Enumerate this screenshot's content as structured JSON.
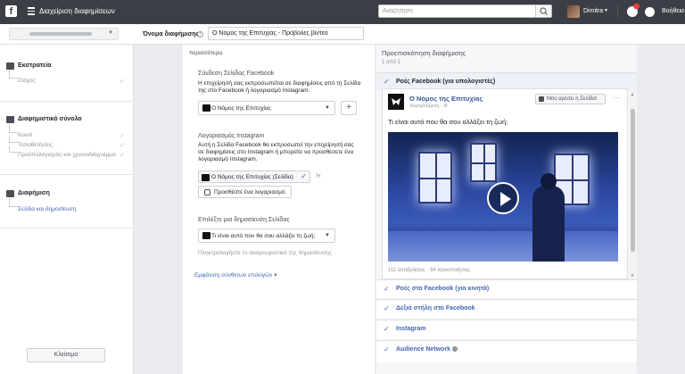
{
  "topbar": {
    "logo": "f",
    "menu_icon": "hamburger-icon",
    "title": "Διαχείριση διαφημίσεων",
    "search_placeholder": "Αναζήτηση",
    "user_name": "Dimitra",
    "help_label": "Βοήθεια"
  },
  "name_bar": {
    "label": "Όνομα διαφήμισης",
    "value": "Ο Νόμος της Επιτυχίας - Προβολές βίντεο"
  },
  "sidebar": {
    "groups": [
      {
        "title": "Εκστρατεία",
        "icon": "folder-icon",
        "items": [
          {
            "label": "Στόχος",
            "checked": true
          }
        ]
      },
      {
        "title": "Διαφημιστικό σύνολο",
        "icon": "grid-icon",
        "items": [
          {
            "label": "Κοινό",
            "checked": true
          },
          {
            "label": "Τοποθετήσεις",
            "checked": true
          },
          {
            "label": "Προϋπολογισμός και χρονοδιάγραμμα",
            "checked": true
          }
        ]
      },
      {
        "title": "Διαφήμιση",
        "icon": "ad-icon",
        "items": [
          {
            "label": "Σελίδα και δημοσίευση",
            "active": true
          }
        ]
      }
    ],
    "close_label": "Κλείσιμο"
  },
  "center": {
    "intro_tail": "περισσότερα.",
    "fb_section": {
      "title": "Σύνδεση Σελίδας Facebook",
      "description_line1": "Η επιχείρησή σας εκπροσωπείται σε διαφημίσεις από τη Σελίδα",
      "description_line2": "της στο Facebook ή λογαριασμό Instagram.",
      "page_value": "Ο Νόμος της Επιτυχίας",
      "plus_label": "+"
    },
    "ig_section": {
      "title": "Λογαριασμός Instagram",
      "description_line1": "Αυτή η Σελίδα Facebook θα εκπροσωπεί την επιχείρησή σας",
      "description_line2": "σε διαφημίσεις στο Instagram ή μπορείτε να προσθέσετε ένα",
      "description_line3": "λογαριασμό Instagram.",
      "selected_page": "Ο Νόμος της Επιτυχίας (Σελίδα)",
      "or_label": "Ή",
      "add_account_label": "Προσθέστε ένα λογαριασμό"
    },
    "post_section": {
      "title": "Επιλέξτε μια δημοσίευση Σελίδας",
      "post_value": "Τι είναι αυτό που θα σου αλλάξει τη ζωή;",
      "hint": "Πληκτρολογήστε το αναγνωριστικό της δημοσίευσης"
    },
    "advanced_link": "Εμφάνιση σύνθετων επιλογών ▾"
  },
  "preview": {
    "title": "Προεπισκόπηση διαφήμισης",
    "count": "1 από 1",
    "placements": [
      {
        "label": "Ροές Facebook (για υπολογιστές)",
        "selected": true
      },
      {
        "label": "Ροές στο Facebook (για κινητά)"
      },
      {
        "label": "Δεξιά στήλη στο Facebook"
      },
      {
        "label": "Instagram"
      },
      {
        "label": "Audience Network",
        "info": true
      }
    ],
    "post": {
      "page_name": "Ο Νόμος της Επιτυχίας",
      "sponsored": "Χορηγούμενη · ⚙",
      "like_button": "Μου αρέσει η Σελίδα!",
      "text": "Τι είναι αυτό που θα σου αλλάξει τη ζωή;",
      "stats": "111 αντιδράσεις · 94 κοινοποιήσεις"
    }
  },
  "colors": {
    "accent": "#4267b2",
    "topbar": "#3b3e44"
  }
}
